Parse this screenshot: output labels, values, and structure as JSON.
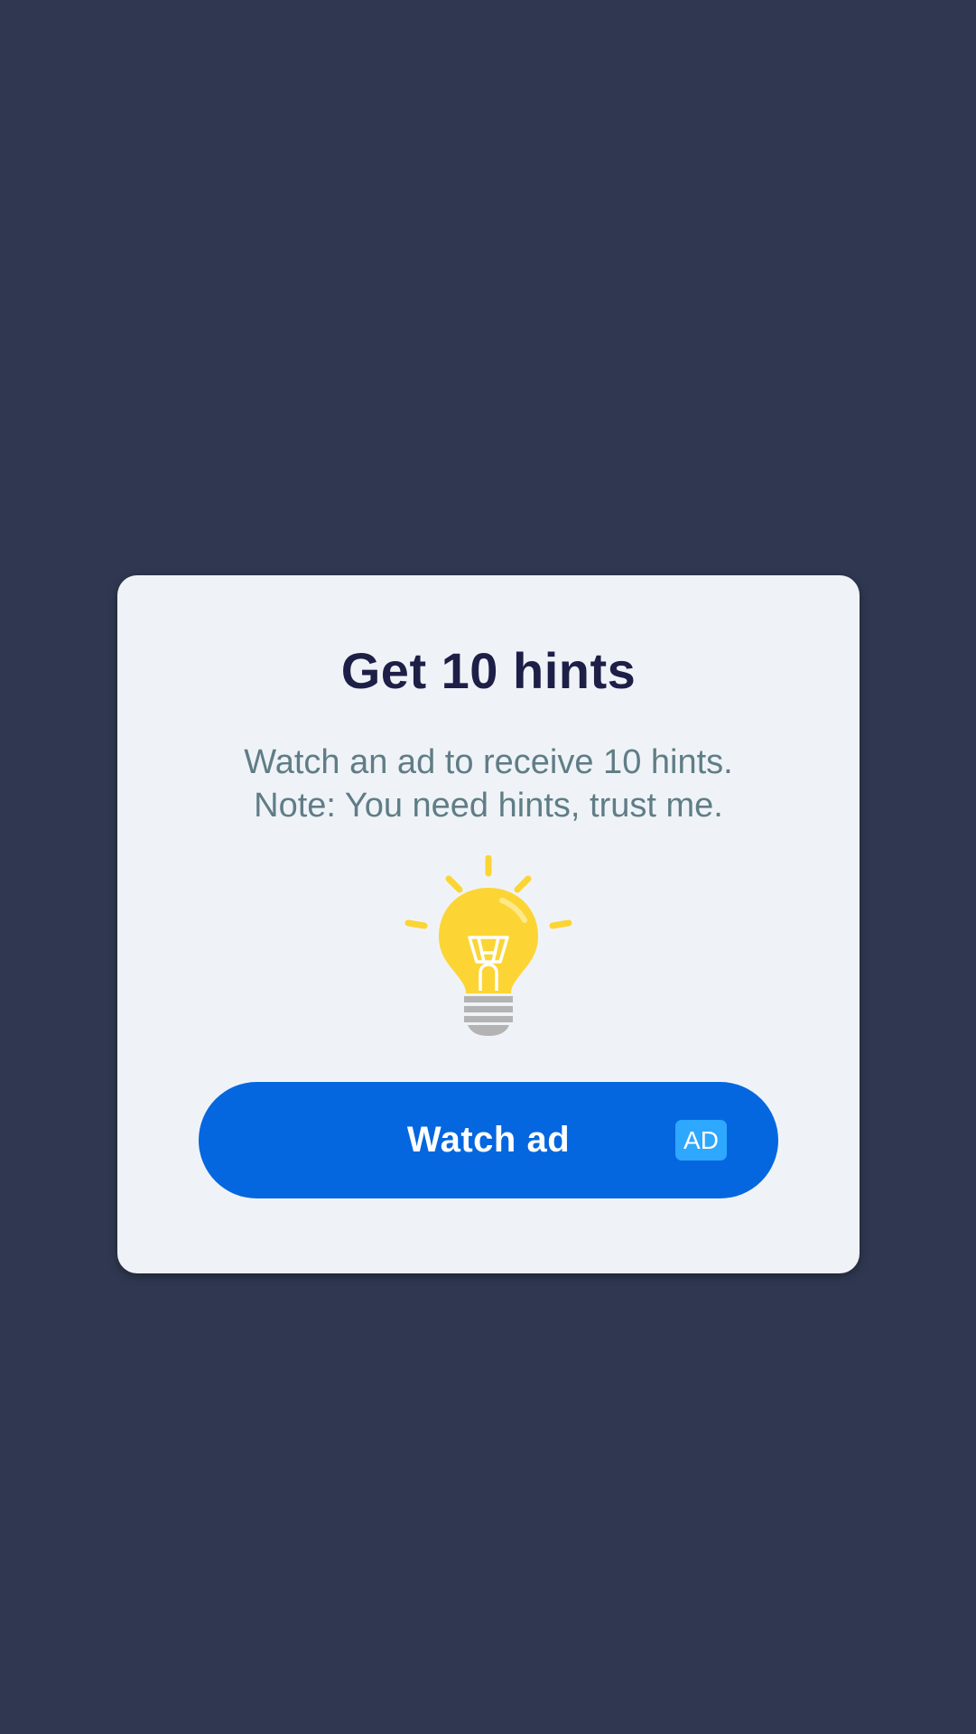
{
  "background_color": "#2f3850",
  "dialog": {
    "title": "Get 10 hints",
    "message_line1": "Watch an ad to receive 10 hints.",
    "message_line2": "Note: You need hints, trust me.",
    "illustration": "lightbulb-icon",
    "button": {
      "label": "Watch ad",
      "badge": "AD",
      "color": "#0567df",
      "badge_color": "#2ea7ff"
    }
  }
}
